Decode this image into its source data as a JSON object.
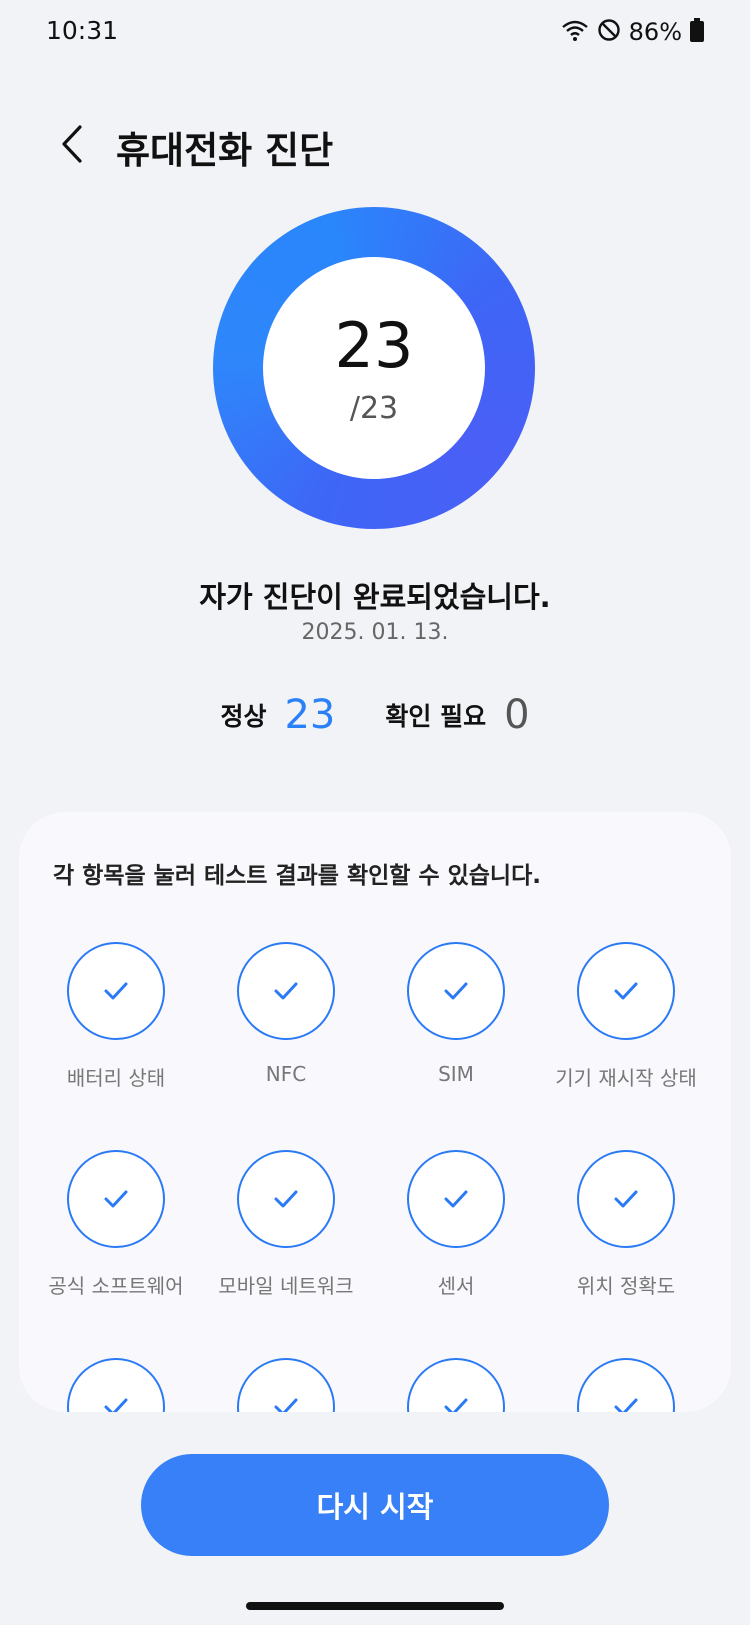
{
  "status_bar": {
    "time": "10:31",
    "battery_percent": "86%"
  },
  "header": {
    "title": "휴대전화 진단"
  },
  "score": {
    "passed": "23",
    "total": "/23"
  },
  "result": {
    "message": "자가 진단이 완료되었습니다.",
    "date": "2025. 01. 13."
  },
  "counts": {
    "normal_label": "정상",
    "normal_value": "23",
    "check_label": "확인 필요",
    "check_value": "0"
  },
  "card": {
    "description": "각 항목을 눌러 테스트 결과를 확인할 수 있습니다.",
    "items": [
      {
        "label": "배터리 상태",
        "status": "pass"
      },
      {
        "label": "NFC",
        "status": "pass"
      },
      {
        "label": "SIM",
        "status": "pass"
      },
      {
        "label": "기기 재시작 상태",
        "status": "pass"
      },
      {
        "label": "공식 소프트웨어",
        "status": "pass"
      },
      {
        "label": "모바일 네트워크",
        "status": "pass"
      },
      {
        "label": "센서",
        "status": "pass"
      },
      {
        "label": "위치 정확도",
        "status": "pass"
      },
      {
        "label": "",
        "status": "pass"
      },
      {
        "label": "",
        "status": "pass"
      },
      {
        "label": "",
        "status": "pass"
      },
      {
        "label": "",
        "status": "pass"
      }
    ]
  },
  "restart_button": {
    "label": "다시 시작"
  },
  "colors": {
    "accent": "#3780f7",
    "ring": "#3e66f6",
    "check": "#2a7af5"
  }
}
